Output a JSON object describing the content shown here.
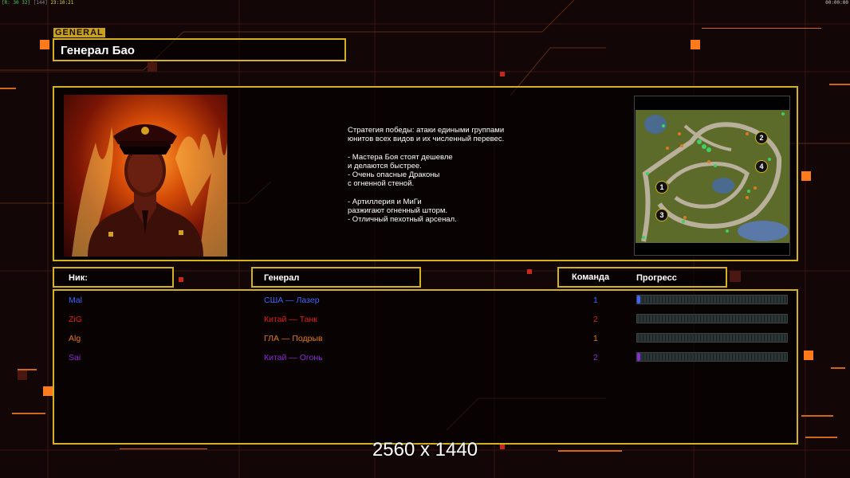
{
  "hud": {
    "top_left": [
      "[R: 30 32]",
      "[144]",
      "23:10:21"
    ],
    "top_right": "00:00:00"
  },
  "general_tag": "GENERAL",
  "title": "Генерал Бао",
  "description": "Стратегия победы: атаки едиными группами\nюнитов всех видов и их численный перевес.\n\n- Мастера Боя стоят дешевле\nи делаются быстрее.\n- Очень опасные Драконы\nс огненной стеной.\n\n- Артиллерия и МиГи\nразжигают огненный шторм.\n- Отличный пехотный арсенал.",
  "columns": {
    "nick": "Ник:",
    "general": "Генерал",
    "team": "Команда",
    "progress": "Прогресс"
  },
  "players": [
    {
      "nick": "Mal",
      "general": "США — Лазер",
      "team": "1",
      "color": "#3f66ff",
      "progress": 0.02
    },
    {
      "nick": "ZiG",
      "general": "Китай — Танк",
      "team": "2",
      "color": "#e02020",
      "progress": 0.0
    },
    {
      "nick": "Alg",
      "general": "ГЛА — Подрыв",
      "team": "1",
      "color": "#e07a20",
      "progress": 0.0
    },
    {
      "nick": "Sai",
      "general": "Китай — Огонь",
      "team": "2",
      "color": "#8a2cd8",
      "progress": 0.02
    }
  ],
  "map_markers": [
    "1",
    "2",
    "3",
    "4"
  ],
  "resolution_text": "2560 x 1440",
  "colors": {
    "accent_gold": "#d4b21d"
  }
}
